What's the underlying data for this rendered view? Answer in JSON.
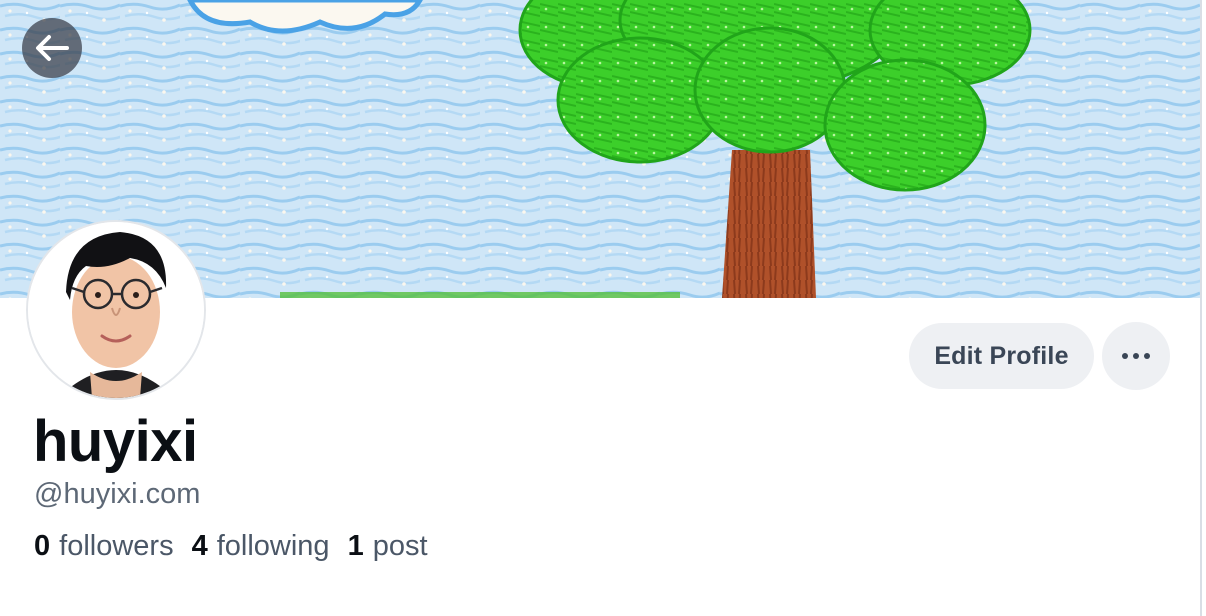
{
  "profile": {
    "display_name": "huyixi",
    "handle": "@huyixi.com",
    "banner_description_icon": "crayon-tree-banner",
    "avatar_icon": "avatar-photo"
  },
  "actions": {
    "back_icon": "arrow-left-icon",
    "edit_profile_label": "Edit Profile",
    "more_icon": "ellipsis-icon"
  },
  "stats": {
    "followers_count": "0",
    "followers_label": "followers",
    "following_count": "4",
    "following_label": "following",
    "posts_count": "1",
    "posts_label": "post"
  },
  "colors": {
    "button_bg": "#eef0f3",
    "text_primary": "#0b0f14",
    "text_secondary": "#5d6876"
  }
}
